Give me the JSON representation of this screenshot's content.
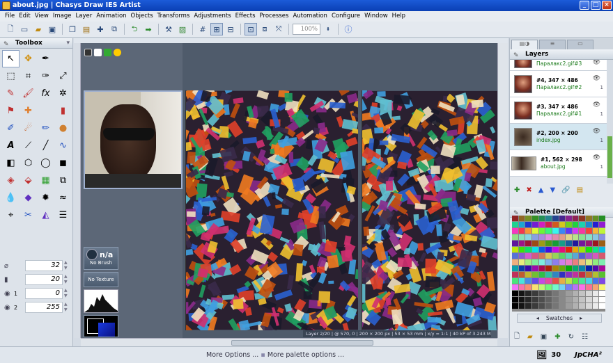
{
  "window": {
    "title": "about.jpg | Chasys Draw IES Artist"
  },
  "menu": [
    "File",
    "Edit",
    "View",
    "Image",
    "Layer",
    "Animation",
    "Objects",
    "Transforms",
    "Adjustments",
    "Effects",
    "Processes",
    "Automation",
    "Configure",
    "Window",
    "Help"
  ],
  "toolbar": {
    "zoom": "100%"
  },
  "toolbox": {
    "title": "Toolbox",
    "props": [
      {
        "icon": "⌀",
        "label": "",
        "value": "32"
      },
      {
        "icon": "▮",
        "label": "",
        "value": "20"
      },
      {
        "icon": "◉",
        "label": "1",
        "value": "0"
      },
      {
        "icon": "◉",
        "label": "2",
        "value": "255"
      }
    ]
  },
  "canvas": {
    "brush_na": "n/a",
    "brush_label": "No Brush",
    "texture_label": "No Texture",
    "status": "Layer 2/20 | @ 570, 0 | 200 × 200 px | 53 × 53 mm | x/y = 1:1 | 40 kP of 3.243 MP"
  },
  "layers": {
    "title": "Layers",
    "items": [
      {
        "name": "",
        "file": "Паралакс2.gif#3",
        "alpha": "1"
      },
      {
        "name": "#4, 347 × 486",
        "file": "Паралакс2.gif#2",
        "alpha": "1"
      },
      {
        "name": "#3, 347 × 486",
        "file": "Паралакс2.gif#1",
        "alpha": "1"
      },
      {
        "name": "#2, 200 × 200",
        "file": "index.jpg",
        "alpha": "1"
      },
      {
        "name": "#1, 562 × 298",
        "file": "about.jpg",
        "alpha": "1"
      }
    ]
  },
  "palette": {
    "title": "Palette [Default]",
    "nav_label": "Swatches"
  },
  "bottom": {
    "more_options": "More Options ...",
    "more_palette": "More palette options ...",
    "count": "30",
    "brand": "JpCHA²"
  },
  "colors": {
    "accent": "#1c5bd8",
    "canvas_bg": "#4f5b6b"
  }
}
